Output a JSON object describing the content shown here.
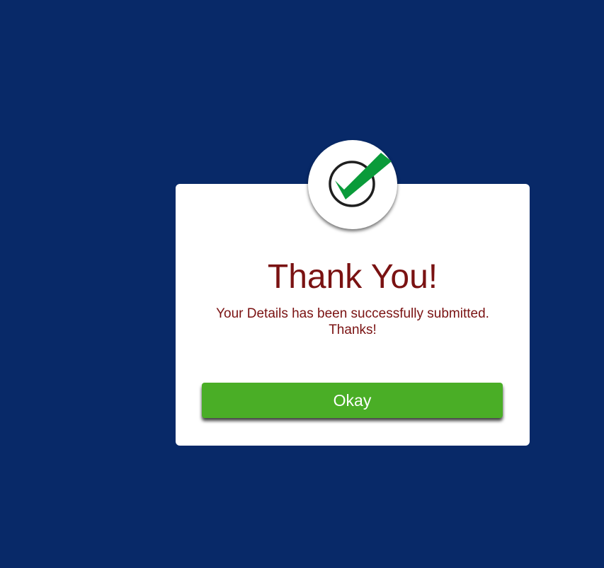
{
  "dialog": {
    "title": "Thank You!",
    "message_line1": "Your Details has been successfully submitted.",
    "message_line2": "Thanks!",
    "okay_label": "Okay",
    "icon": "check-circle-icon"
  },
  "colors": {
    "background": "#082968",
    "card": "#ffffff",
    "text": "#7a1212",
    "button": "#4aae26",
    "check": "#0a9b3a",
    "ring": "#1f1f1f"
  }
}
